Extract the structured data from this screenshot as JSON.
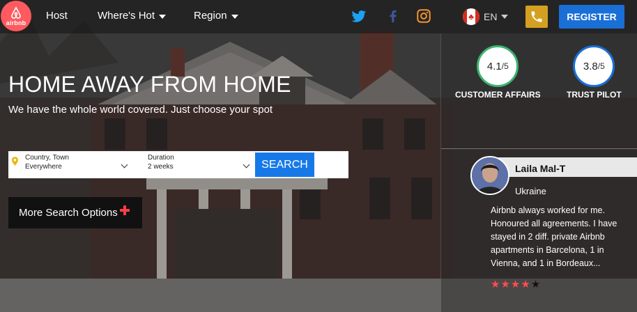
{
  "brand": {
    "logo_text": "airbnb",
    "accent": "#fe5a5f"
  },
  "nav": {
    "host": "Host",
    "wheres_hot": "Where's Hot",
    "region": "Region"
  },
  "social": [
    {
      "icon": "twitter-icon",
      "color": "#1da1f2"
    },
    {
      "icon": "facebook-icon",
      "color": "#3b5998"
    },
    {
      "icon": "instagram-icon",
      "color": "#f09433"
    }
  ],
  "language": {
    "code": "EN",
    "flag": "canada-flag-icon"
  },
  "phone": {
    "icon": "phone-icon",
    "color": "#d4a021"
  },
  "register": {
    "label": "REGISTER",
    "color": "#1a6fd6"
  },
  "ratings": [
    {
      "value": "4.1",
      "max": "/5",
      "label": "CUSTOMER AFFAIRS",
      "ring": "#3cb371"
    },
    {
      "value": "3.8",
      "max": "/5",
      "label": "TRUST PILOT",
      "ring": "#1a6fd6"
    }
  ],
  "review": {
    "name": "Laila Mal-T",
    "country": "Ukraine",
    "text": "Airbnb always worked for me. Honoured all agreements. I have stayed in 2 diff. private Airbnb apartments in Barcelona, 1 in Vienna, and 1 in Bordeaux...",
    "stars_filled": 4,
    "stars_total": 5
  },
  "hero": {
    "title": "HOME AWAY FROM HOME",
    "subtitle": "We have the whole world covered. Just choose your spot"
  },
  "search": {
    "location_label": "Country, Town",
    "location_value": "Everywhere",
    "duration_label": "Duration",
    "duration_value": "2 weeks",
    "button": "SEARCH"
  },
  "more_options": {
    "label": "More Search Options"
  }
}
